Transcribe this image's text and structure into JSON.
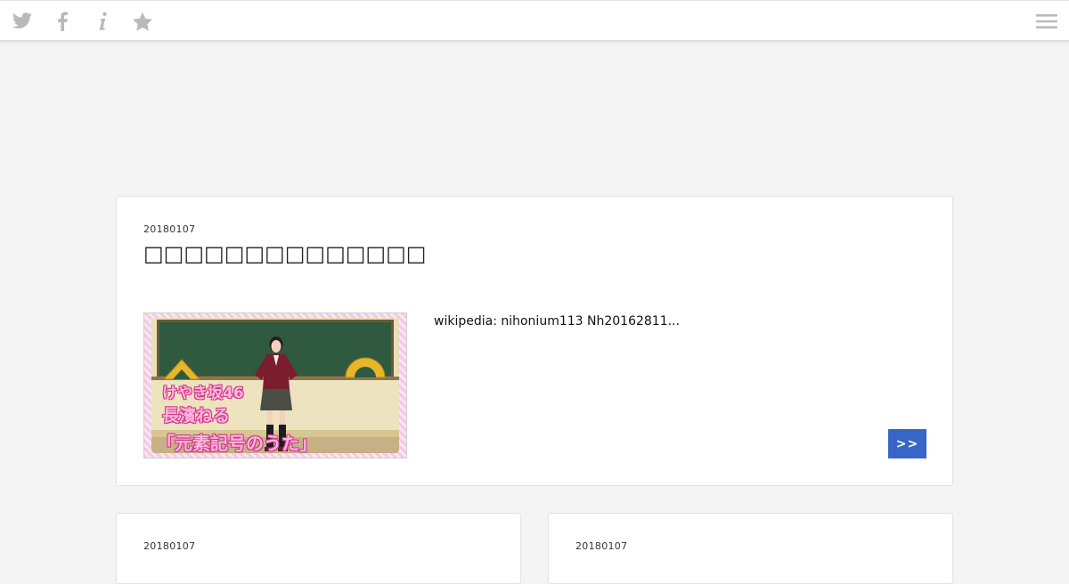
{
  "topbar": {
    "icons": [
      "twitter-icon",
      "facebook-icon",
      "info-icon",
      "star-icon",
      "menu-icon"
    ]
  },
  "featured_post": {
    "date": "20180107",
    "title": "□□□□□□□□□□□□□□",
    "thumbnail_caption": {
      "line1": "けやき坂46",
      "line2": "長濱ねる",
      "line3": "「元素記号のうた」"
    },
    "excerpt": "wikipedia: nihonium113 Nh20162811...",
    "more_label": ">>"
  },
  "posts": [
    {
      "date": "20180107"
    },
    {
      "date": "20180107"
    }
  ],
  "colors": {
    "page_background": "#f4f4f4",
    "topbar_background": "#ffffff",
    "icon_gray": "#b9b9b9",
    "button_blue": "#3766c7"
  }
}
